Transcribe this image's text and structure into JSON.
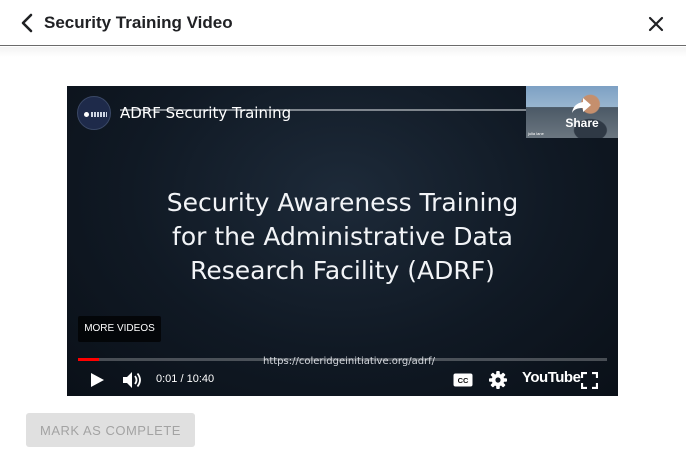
{
  "header": {
    "title": "Security Training Video"
  },
  "video": {
    "title": "ADRF Security Training",
    "share_label": "Share",
    "presenter_caption": "julia lane",
    "slide_lines": [
      "Security Awareness Training",
      "for the Administrative Data",
      "Research Facility (ADRF)"
    ],
    "more_videos_label": "MORE VIDEOS",
    "url_text": "https://coleridgeinitiative.org/adrf/",
    "time_text": "0:01 / 10:40",
    "progress_fraction": 0.04,
    "youtube_label": "YouTube"
  },
  "actions": {
    "mark_complete_label": "MARK AS COMPLETE"
  },
  "icons": {
    "back": "chevron-left-icon",
    "close": "close-icon",
    "share": "share-arrow-icon",
    "play": "play-icon",
    "volume": "volume-icon",
    "cc": "closed-captions-icon",
    "settings": "gear-icon",
    "fullscreen": "fullscreen-icon"
  },
  "colors": {
    "progress": "#ff0000",
    "button_disabled_bg": "#e0e0e0",
    "button_disabled_text": "#a3a3a3"
  }
}
